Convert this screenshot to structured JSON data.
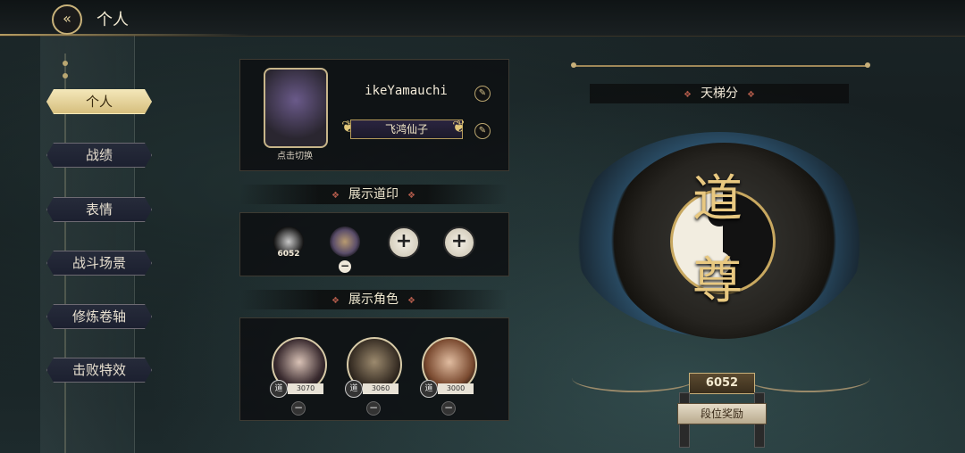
{
  "header": {
    "title": "个人",
    "back_icon": "back-arrow-icon"
  },
  "sidebar": {
    "items": [
      {
        "label": "个人",
        "active": true
      },
      {
        "label": "战绩",
        "active": false
      },
      {
        "label": "表情",
        "active": false
      },
      {
        "label": "战斗场景",
        "active": false
      },
      {
        "label": "修炼卷轴",
        "active": false
      },
      {
        "label": "击败特效",
        "active": false
      }
    ]
  },
  "profile": {
    "avatar_caption": "点击切换",
    "player_name": "ikeYamauchi",
    "title": "飞鸿仙子"
  },
  "seals": {
    "section_title": "展示道印",
    "first_count": "6052"
  },
  "characters": {
    "section_title": "展示角色",
    "items": [
      {
        "badge": "道",
        "score": "3070"
      },
      {
        "badge": "道",
        "score": "3060"
      },
      {
        "badge": "道",
        "score": "3000"
      }
    ]
  },
  "ladder": {
    "title": "天梯分",
    "rank_top": "道",
    "rank_bottom": "尊",
    "score": "6052",
    "reward_label": "段位奖励"
  },
  "colors": {
    "accent_gold": "#c8b07a",
    "active_tab": "#e8d498"
  }
}
